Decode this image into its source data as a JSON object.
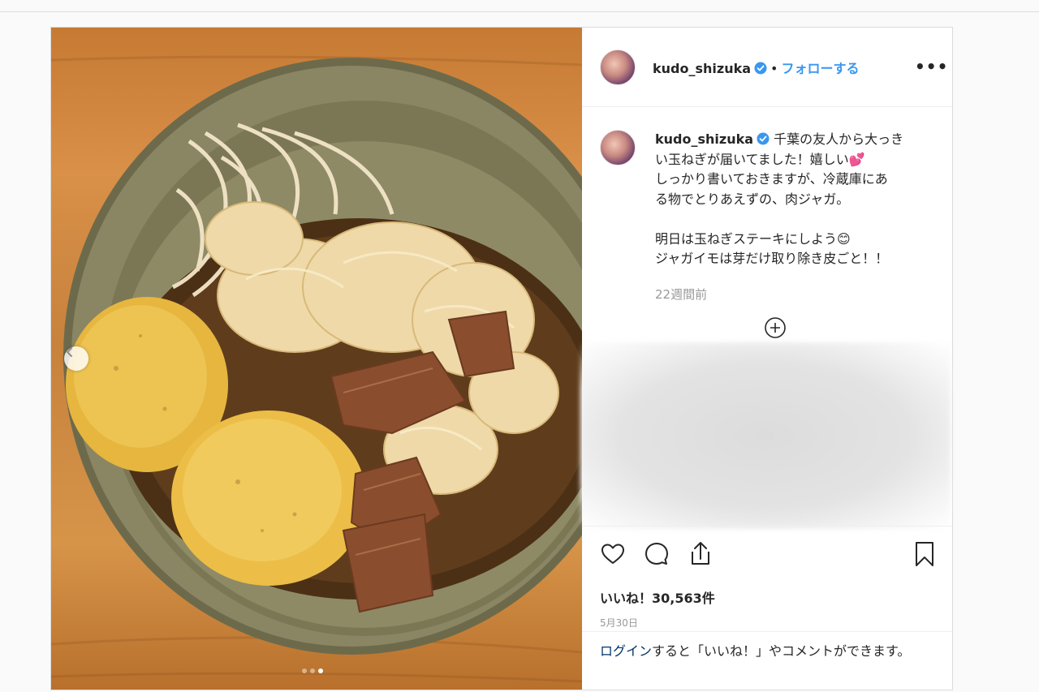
{
  "post": {
    "username": "kudo_shizuka",
    "follow_label": "フォローする",
    "more_label": "•••",
    "bullet": "•",
    "caption_lines": [
      "千葉の友人から大っき",
      "い玉ねぎが届いてました！嬉しい💕",
      "しっかり書いておきますが、冷蔵庫にあ",
      "る物でとりあえずの、肉ジャガ。",
      "",
      "明日は玉ねぎステーキにしよう😊",
      "ジャガイモは芽だけ取り除き皮ごと！！"
    ],
    "time_ago": "22週間前",
    "likes": "いいね！30,563件",
    "date": "5月30日",
    "login_link": "ログイン",
    "login_rest": "すると「いいね！」やコメントができます。",
    "carousel": {
      "total": 3,
      "active_index": 2
    }
  },
  "icons": {
    "prev": "chevron-left-icon",
    "verified": "verified-badge-icon",
    "more": "more-options-icon",
    "load_more": "plus-circle-icon",
    "like": "heart-icon",
    "comment": "comment-icon",
    "share": "share-icon",
    "save": "bookmark-icon"
  },
  "colors": {
    "link_blue": "#3897f0",
    "verified_blue": "#3897f0",
    "text": "#262626",
    "muted": "#999999",
    "border": "#dbdbdb"
  }
}
